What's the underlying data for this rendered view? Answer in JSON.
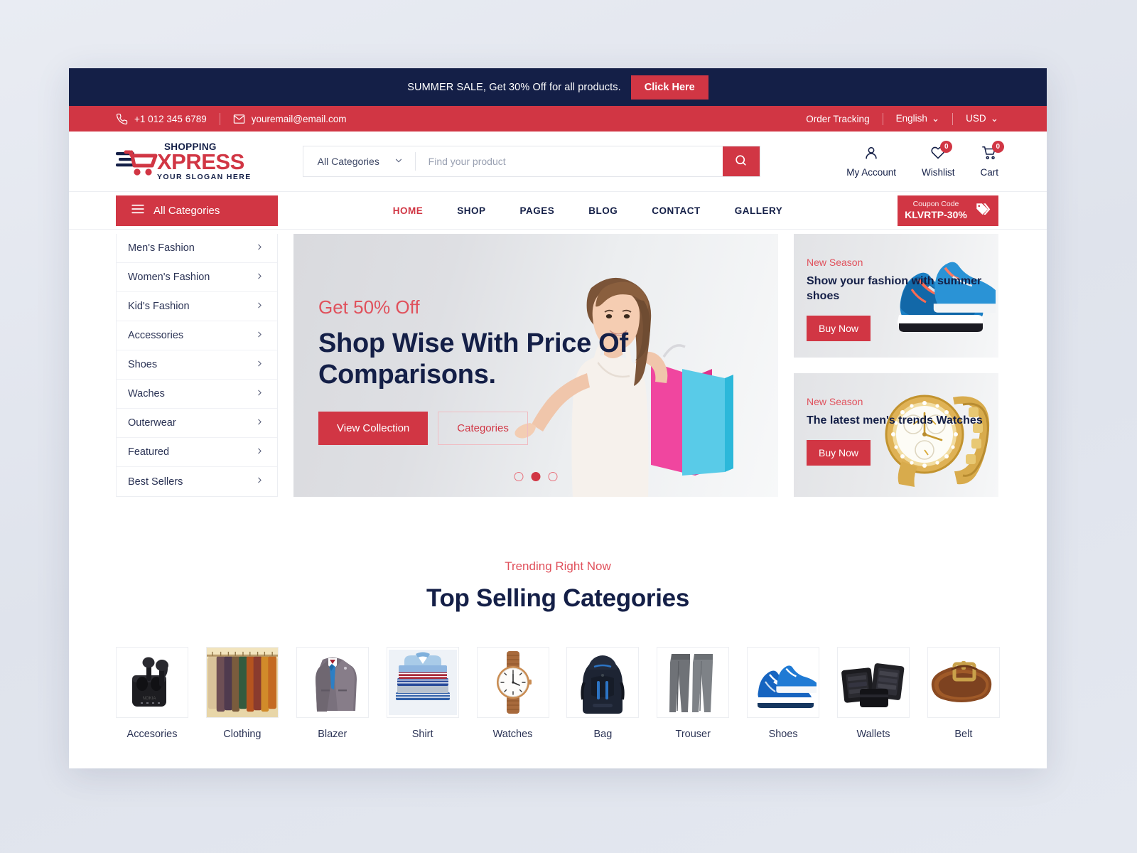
{
  "announcement": {
    "text": "SUMMER SALE, Get 30% Off for all products.",
    "button": "Click Here"
  },
  "utility": {
    "phone": "+1 012 345 6789",
    "email": "youremail@email.com",
    "order_tracking": "Order Tracking",
    "language": "English",
    "currency": "USD"
  },
  "logo": {
    "top": "SHOPPING",
    "main": "XPRESS",
    "slogan": "YOUR SLOGAN HERE"
  },
  "search": {
    "category": "All Categories",
    "placeholder": "Find your product",
    "value": ""
  },
  "actions": {
    "account": "My Account",
    "wishlist": "Wishlist",
    "wishlist_count": "0",
    "cart": "Cart",
    "cart_count": "0"
  },
  "nav": {
    "all_categories": "All Categories",
    "links": [
      {
        "label": "HOME",
        "active": true
      },
      {
        "label": "SHOP",
        "active": false
      },
      {
        "label": "PAGES",
        "active": false
      },
      {
        "label": "BLOG",
        "active": false
      },
      {
        "label": "CONTACT",
        "active": false
      },
      {
        "label": "GALLERY",
        "active": false
      }
    ],
    "coupon_label": "Coupon Code",
    "coupon_code": "KLVRTP-30%"
  },
  "sidebar": {
    "items": [
      {
        "label": "Men's Fashion"
      },
      {
        "label": "Women's Fashion"
      },
      {
        "label": "Kid's Fashion"
      },
      {
        "label": "Accessories"
      },
      {
        "label": "Shoes"
      },
      {
        "label": "Waches"
      },
      {
        "label": "Outerwear"
      },
      {
        "label": "Featured"
      },
      {
        "label": "Best Sellers"
      }
    ]
  },
  "hero": {
    "eyebrow": "Get 50% Off",
    "title": "Shop Wise With Price Of Comparisons.",
    "btn_primary": "View Collection",
    "btn_secondary": "Categories",
    "active_slide": 2,
    "slide_count": 3
  },
  "promos": [
    {
      "eyebrow": "New Season",
      "title": "Show your fashion with summer shoes",
      "button": "Buy Now"
    },
    {
      "eyebrow": "New Season",
      "title": "The latest men's trends Watches",
      "button": "Buy Now"
    }
  ],
  "top_selling": {
    "eyebrow": "Trending Right Now",
    "title": "Top Selling Categories",
    "categories": [
      {
        "label": "Accesories"
      },
      {
        "label": "Clothing"
      },
      {
        "label": "Blazer"
      },
      {
        "label": "Shirt"
      },
      {
        "label": "Watches"
      },
      {
        "label": "Bag"
      },
      {
        "label": "Trouser"
      },
      {
        "label": "Shoes"
      },
      {
        "label": "Wallets"
      },
      {
        "label": "Belt"
      }
    ]
  },
  "colors": {
    "navy": "#141f47",
    "red": "#d13644",
    "text": "#2b3355"
  }
}
